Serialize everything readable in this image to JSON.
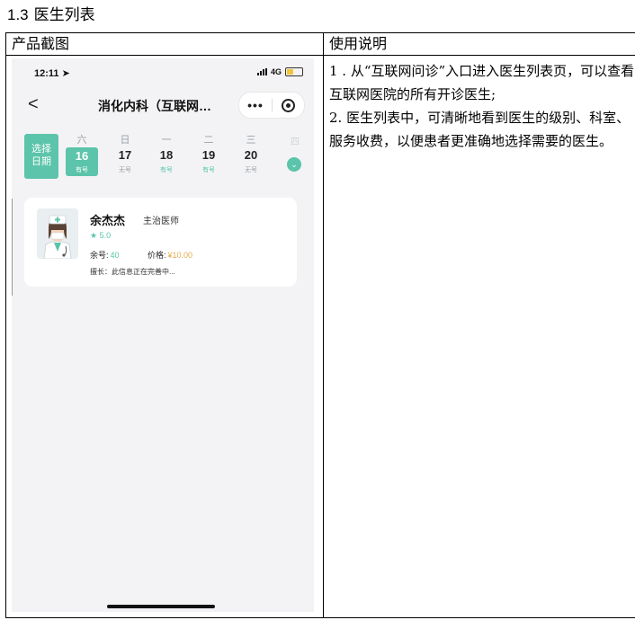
{
  "section": {
    "number": "1.3",
    "title": "医生列表"
  },
  "table": {
    "col1_header": "产品截图",
    "col2_header": "使用说明"
  },
  "screenshot": {
    "status": {
      "time": "12:11",
      "network": "4G"
    },
    "nav": {
      "back": "<",
      "title": "消化内科（互联网…",
      "more": "•••"
    },
    "date_button": {
      "line1": "选择",
      "line2": "日期"
    },
    "days": [
      {
        "weekday": "六",
        "date": "16",
        "status": "有号"
      },
      {
        "weekday": "日",
        "date": "17",
        "status": "无号"
      },
      {
        "weekday": "一",
        "date": "18",
        "status": "有号"
      },
      {
        "weekday": "二",
        "date": "19",
        "status": "有号"
      },
      {
        "weekday": "三",
        "date": "20",
        "status": "无号"
      }
    ],
    "next_weekday": "四",
    "doctor": {
      "name": "余杰杰",
      "title": "主治医师",
      "rating": "★ 5.0",
      "remain_label": "余号:",
      "remain_value": "40",
      "price_label": "价格:",
      "price_value": "¥10.00",
      "specialty": "擅长：此信息正在完善中..."
    },
    "colors": {
      "accent": "#5bc4aa",
      "price": "#e8a94b"
    }
  },
  "description": [
    "1 . 从“互联网问诊”入口进入医生列表页，可以查看互联网医院的所有开诊医生;",
    "2.   医生列表中，可清晰地看到医生的级别、科室、服务收费，以便患者更准确地选择需要的医生。"
  ]
}
